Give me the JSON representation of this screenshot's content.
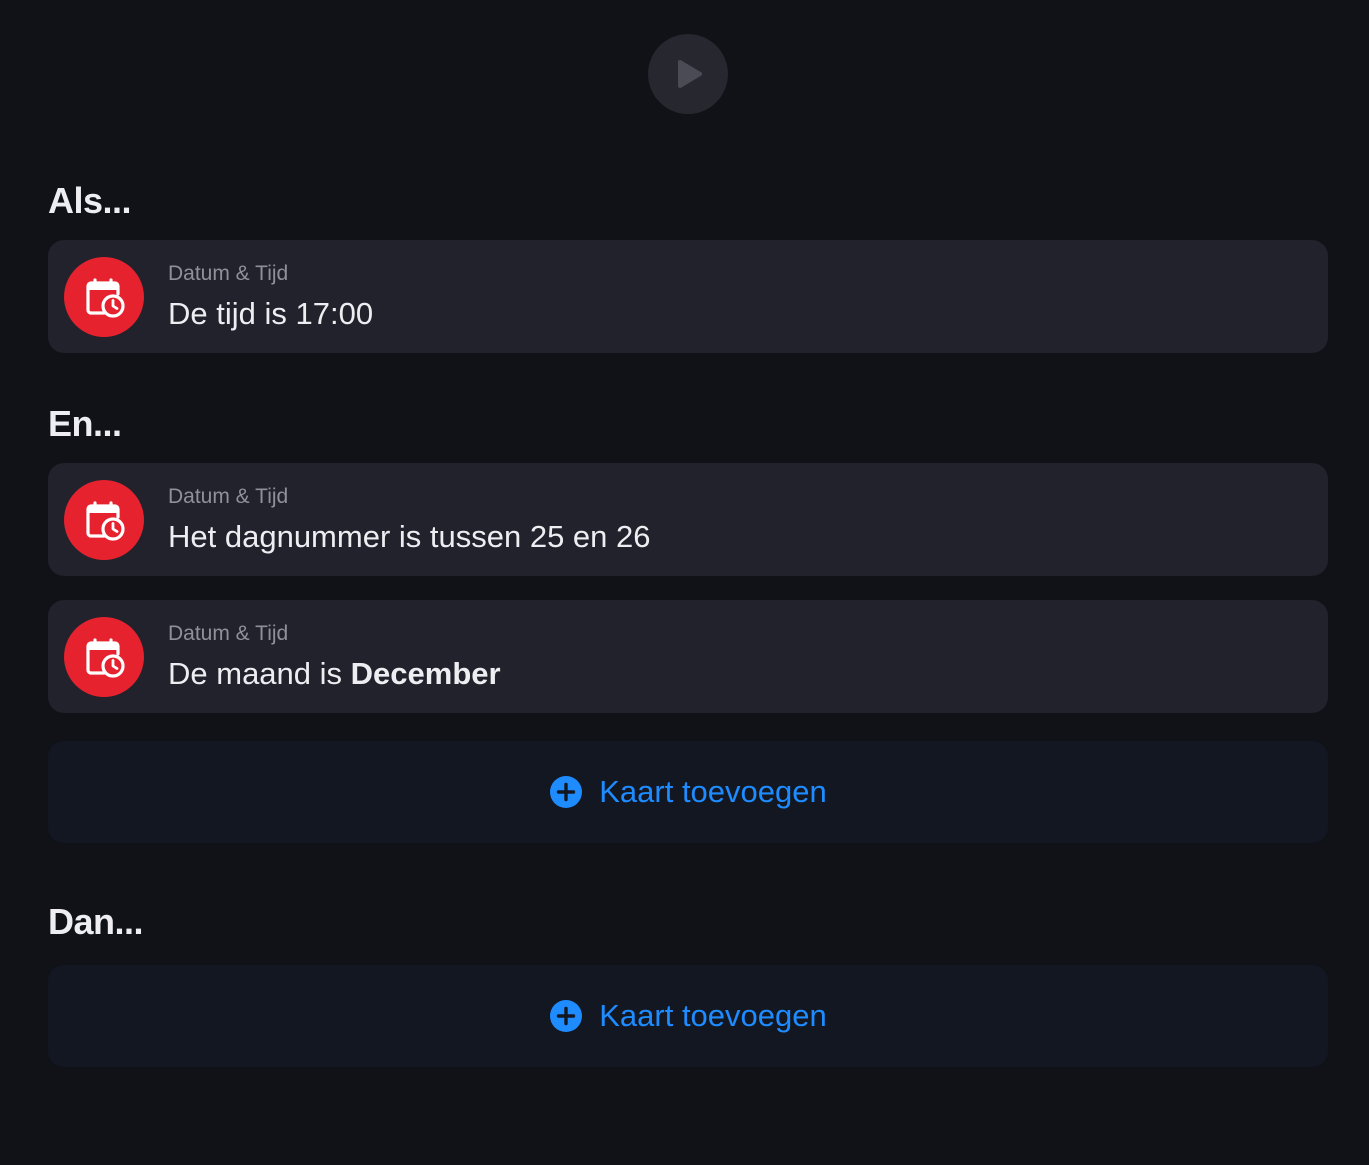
{
  "flow": {
    "play_icon": "play-icon"
  },
  "sections": {
    "if": {
      "title": "Als..."
    },
    "and": {
      "title": "En..."
    },
    "then": {
      "title": "Dan..."
    }
  },
  "cards": {
    "trigger": {
      "icon": "calendar-clock-icon",
      "category": "Datum & Tijd",
      "prefix": "De tijd is ",
      "value": "17:00"
    },
    "condition_day": {
      "icon": "calendar-clock-icon",
      "category": "Datum & Tijd",
      "prefix": "Het dagnummer is tussen ",
      "value1": "25",
      "middle": " en ",
      "value2": "26"
    },
    "condition_month": {
      "icon": "calendar-clock-icon",
      "category": "Datum & Tijd",
      "prefix": "De maand is ",
      "value": "December"
    }
  },
  "add_card": {
    "label": "Kaart toevoegen",
    "icon": "plus-circle-icon"
  },
  "colors": {
    "background": "#111217",
    "card": "#21222b",
    "add_card": "#121722",
    "accent_red": "#e5222e",
    "accent_blue": "#1e8bff"
  }
}
